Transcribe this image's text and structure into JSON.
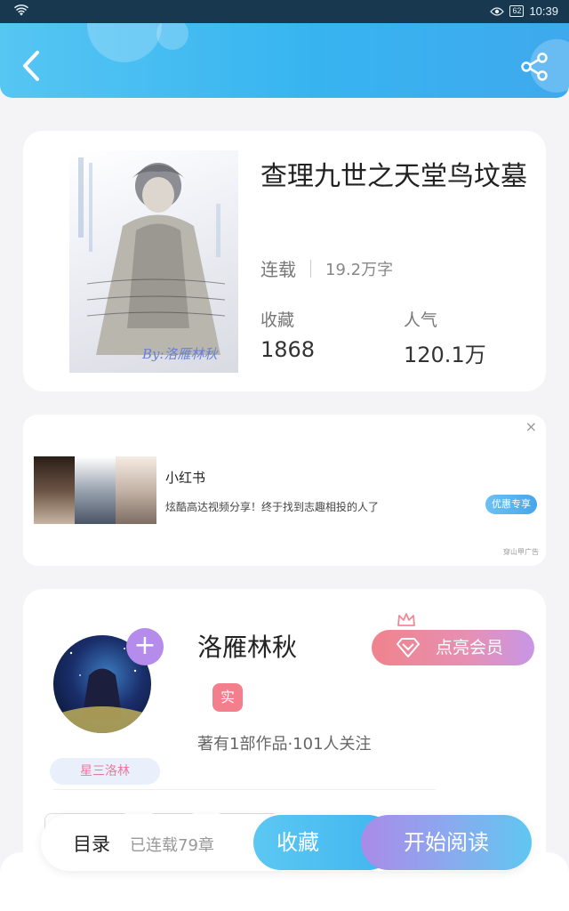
{
  "status_bar": {
    "battery": "62",
    "time": "10:39"
  },
  "book": {
    "title": "查理九世之天堂鸟坟墓",
    "status": "连载",
    "word_count": "19.2万字",
    "favorites_label": "收藏",
    "favorites_value": "1868",
    "popularity_label": "人气",
    "popularity_value": "120.1万",
    "cover_signature": "By:洛雁林秋"
  },
  "ad": {
    "title": "小红书",
    "description": "炫酷高达视频分享！终于找到志趣相投的人了",
    "button": "优惠专享",
    "source": "穿山甲广告",
    "close": "×"
  },
  "author": {
    "name": "洛雁林秋",
    "verified_badge": "实",
    "stats": "著有1部作品·101人关注",
    "level_badge": "星三洛林",
    "vip_button": "点亮会员",
    "add_symbol": "+"
  },
  "bottom_bar": {
    "toc_label": "目录",
    "chapter_count": "已连载79章",
    "favorite_button": "收藏",
    "read_button": "开始阅读"
  },
  "colors": {
    "header": "#37b4f0",
    "accent_pink": "#f0838c",
    "accent_purple": "#b58bec"
  }
}
